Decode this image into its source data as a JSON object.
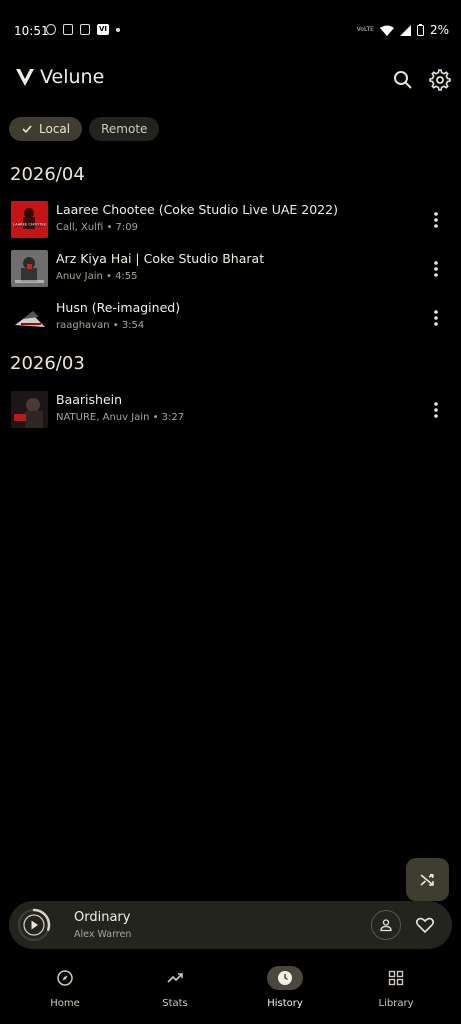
{
  "status_bar": {
    "time": "10:51",
    "vi_label": "VI",
    "network_label": "VoLTE",
    "battery": "2%"
  },
  "app": {
    "name": "Velune",
    "icons": {
      "search": "search-icon",
      "settings": "gear-icon"
    }
  },
  "filters": [
    {
      "label": "Local",
      "selected": true
    },
    {
      "label": "Remote",
      "selected": false
    }
  ],
  "sections": [
    {
      "title": "2026/04",
      "tracks": [
        {
          "title": "Laaree Chootee (Coke Studio Live UAE 2022)",
          "subtitle": "Call, Xulfi • 7:09",
          "thumb_caption": "LAAREE CHOOTEE"
        },
        {
          "title": "Arz Kiya Hai | Coke Studio Bharat",
          "subtitle": "Anuv Jain • 4:55"
        },
        {
          "title": "Husn (Re-imagined)",
          "subtitle": "raaghavan • 3:54"
        }
      ]
    },
    {
      "title": "2026/03",
      "tracks": [
        {
          "title": "Baarishein",
          "subtitle": "NATURE, Anuv Jain • 3:27"
        }
      ]
    }
  ],
  "mini_player": {
    "title": "Ordinary",
    "artist": "Alex Warren",
    "progress_fraction": 0.3
  },
  "nav": [
    {
      "label": "Home",
      "icon": "compass-icon",
      "active": false
    },
    {
      "label": "Stats",
      "icon": "trending-icon",
      "active": false
    },
    {
      "label": "History",
      "icon": "clock-icon",
      "active": true
    },
    {
      "label": "Library",
      "icon": "grid-icon",
      "active": false
    }
  ]
}
